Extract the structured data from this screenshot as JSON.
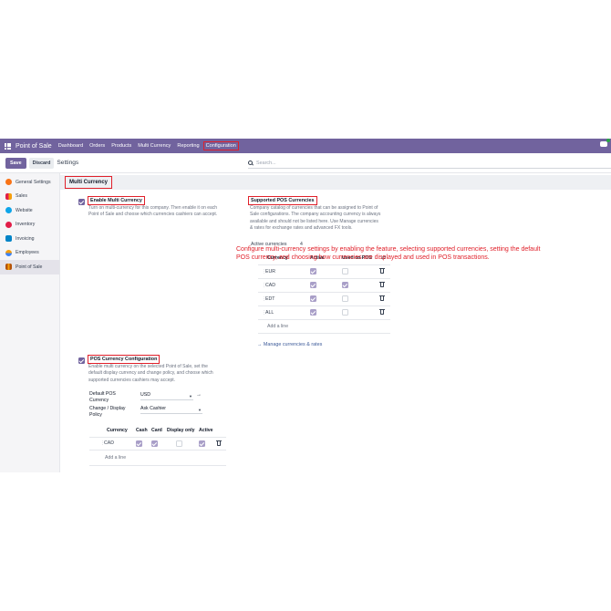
{
  "navbar": {
    "app_name": "Point of Sale",
    "menu": [
      "Dashboard",
      "Orders",
      "Products",
      "Multi Currency",
      "Reporting",
      "Configuration"
    ],
    "highlighted": "Configuration"
  },
  "control": {
    "save_label": "Save",
    "discard_label": "Discard",
    "breadcrumb": "Settings",
    "search_placeholder": "Search..."
  },
  "sidebar": {
    "items": [
      {
        "label": "General Settings",
        "icon": "general-settings-icon",
        "color": "#f97316"
      },
      {
        "label": "Sales",
        "icon": "sales-icon",
        "color": "#e11d48"
      },
      {
        "label": "Website",
        "icon": "website-icon",
        "color": "#0ea5e9"
      },
      {
        "label": "Inventory",
        "icon": "inventory-icon",
        "color": "#e11d48"
      },
      {
        "label": "Invoicing",
        "icon": "invoicing-icon",
        "color": "#0284c7"
      },
      {
        "label": "Employees",
        "icon": "employees-icon",
        "color": "#f59e0b"
      },
      {
        "label": "Point of Sale",
        "icon": "point-of-sale-icon",
        "color": "#b45309"
      }
    ],
    "active": "Point of Sale"
  },
  "section": {
    "title": "Multi Currency"
  },
  "enable_multi": {
    "title": "Enable Multi Currency",
    "description": [
      "Turn on multi-currency for this company. Then enable it on each",
      "Point of Sale and choose which currencies cashiers can accept."
    ]
  },
  "supported": {
    "title": "Supported POS Currencies",
    "description": [
      "Company catalog of currencies that can be assigned to Point of",
      "Sale configurations. The company accounting currency is always",
      "available and should not be listed here. Use Manage currencies",
      "& rates for exchange rates and advanced FX tools."
    ],
    "active_label": "Active currencies",
    "active_count": "4",
    "columns": [
      "Currency",
      "Active",
      "Used on POS"
    ],
    "rows": [
      {
        "currency": "EUR",
        "active": true,
        "used": false
      },
      {
        "currency": "CAD",
        "active": true,
        "used": true
      },
      {
        "currency": "EDT",
        "active": true,
        "used": false
      },
      {
        "currency": "ALL",
        "active": true,
        "used": false
      }
    ],
    "add_line": "Add a line",
    "manage_link": "→  Manage currencies & rates"
  },
  "pos_config": {
    "title": "POS Currency Configuration",
    "description": [
      "Enable multi currency on the selected Point of Sale, set the",
      "default display currency and change policy, and choose which",
      "supported currencies cashiers may accept."
    ],
    "default_label": [
      "Default POS",
      "Currency"
    ],
    "default_value": "USD",
    "policy_label": [
      "Change / Display",
      "Policy"
    ],
    "policy_value": "Ask Cashier",
    "columns": [
      "Currency",
      "Cash",
      "Card",
      "Display only",
      "Active"
    ],
    "rows": [
      {
        "currency": "CAD",
        "cash": true,
        "card": true,
        "display_only": false,
        "active": true
      }
    ],
    "add_line": "Add a line"
  },
  "annotation": [
    "Configure multi-currency settings by enabling the feature, selecting supported currencies, setting the default",
    "POS currency, and choosing how currencies are displayed and used in POS transactions."
  ]
}
